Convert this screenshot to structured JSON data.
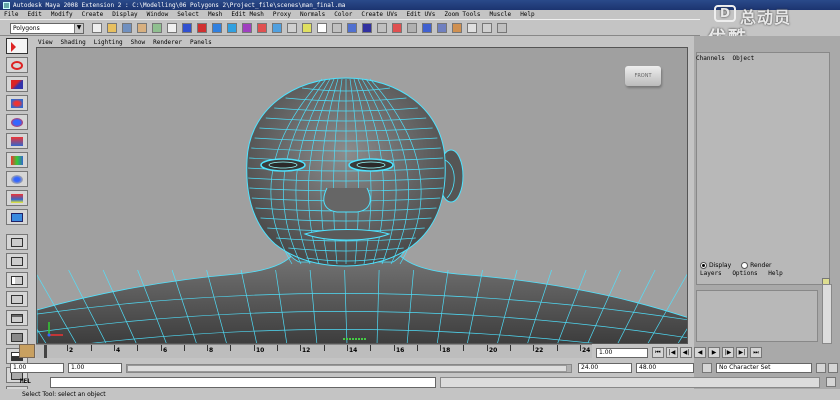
{
  "window": {
    "title": "Autodesk Maya 2008 Extension 2 : C:\\Modelling\\06 Polygons 2\\Project_file\\scenes\\man_final.ma"
  },
  "watermark": {
    "logo": "D",
    "line1": "总动员",
    "line2": "优酷"
  },
  "menubar": {
    "items": [
      "File",
      "Edit",
      "Modify",
      "Create",
      "Display",
      "Window",
      "Select",
      "Mesh",
      "Edit Mesh",
      "Proxy",
      "Normals",
      "Color",
      "Create UVs",
      "Edit UVs",
      "Zoom Tools",
      "Muscle",
      "Help"
    ]
  },
  "statusline": {
    "mode_selector": "Polygons"
  },
  "panel": {
    "menu_items": [
      "View",
      "Shading",
      "Lighting",
      "Show",
      "Renderer",
      "Panels"
    ],
    "viewcube_label": "FRONT"
  },
  "channel_box": {
    "header_items": [
      "Channels",
      "Object"
    ],
    "display_label": "Display",
    "render_label": "Render",
    "display_selected": true,
    "layer_menu": [
      "Layers",
      "Options",
      "Help"
    ]
  },
  "time_slider": {
    "ticks": [
      "2",
      "4",
      "6",
      "8",
      "10",
      "12",
      "14",
      "16",
      "18",
      "20",
      "22",
      "24"
    ],
    "current_frame": "1.00"
  },
  "range_slider": {
    "start_time": "1.00",
    "playback_start": "1.00",
    "playback_end": "24.00",
    "end_time": "48.00",
    "character_set": "No Character Set"
  },
  "command_line": {
    "label": "MEL",
    "value": ""
  },
  "help_line": {
    "text": "Select Tool: select an object"
  },
  "colors": {
    "wireframe": "#4fe3ff",
    "viewport_bg": "#a0a0a0",
    "title_bar": "#1c3470"
  }
}
